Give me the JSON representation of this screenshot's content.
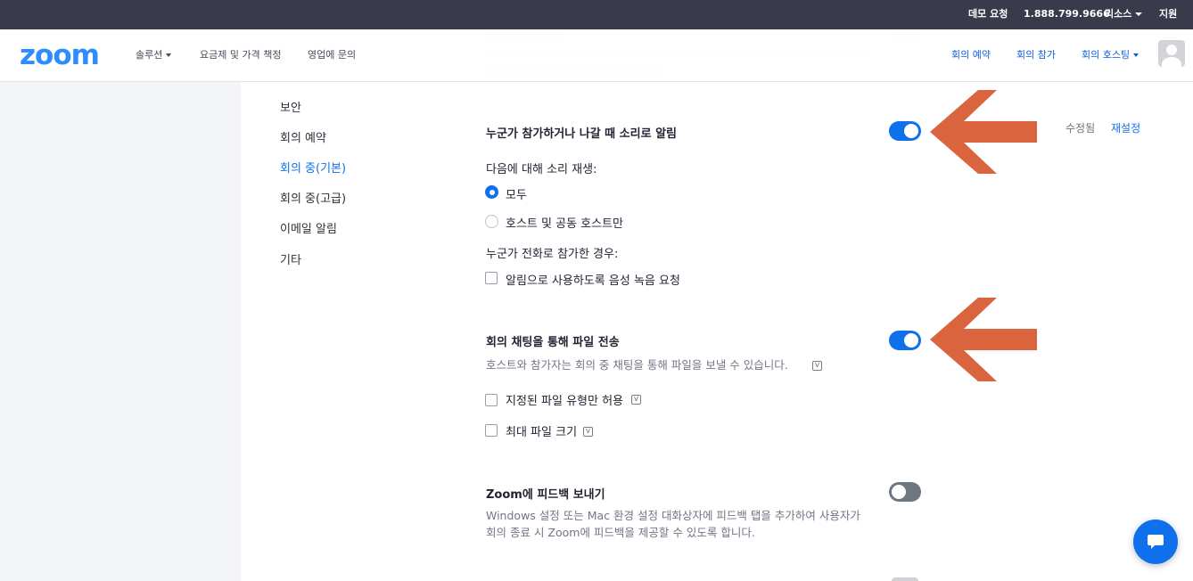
{
  "topbar": {
    "demo": "데모 요청",
    "phone": "1.888.799.9666",
    "resources": "리소스",
    "support": "지원"
  },
  "nav": {
    "logo": "zoom",
    "solutions": "솔루션",
    "pricing": "요금제 및 가격 책정",
    "contact_sales": "영업에 문의",
    "schedule": "회의 예약",
    "join": "회의 참가",
    "host": "회의 호스팅"
  },
  "sidebar": {
    "items": [
      {
        "label": "보안"
      },
      {
        "label": "회의 예약"
      },
      {
        "label": "회의 중(기본)"
      },
      {
        "label": "회의 중(고급)"
      },
      {
        "label": "이메일 알림"
      },
      {
        "label": "기타"
      }
    ]
  },
  "settings": {
    "sound": {
      "title": "누군가 참가하거나 나갈 때 소리로 알림",
      "play_for": "다음에 대해 소리 재생:",
      "opt_all": "모두",
      "opt_host": "호스트 및 공동 호스트만",
      "phone_join": "누군가 전화로 참가한 경우:",
      "record_name": "알림으로 사용하도록 음성 녹음 요청",
      "modified": "수정됨",
      "reset": "재설정",
      "enabled": true
    },
    "file_transfer": {
      "title": "회의 채팅을 통해 파일 전송",
      "desc": "호스트와 참가자는 회의 중 채팅을 통해 파일을 보낼 수 있습니다.",
      "opt_types": "지정된 파일 유형만 허용",
      "opt_size": "최대 파일 크기",
      "enabled": true
    },
    "feedback": {
      "title": "Zoom에 피드백 보내기",
      "desc": "Windows 설정 또는 Mac 환경 설정 대화상자에 피드백 탭을 추가하여 사용자가 회의 종료 시 Zoom에 피드백을 제공할 수 있도록 합니다.",
      "enabled": false
    }
  },
  "colors": {
    "accent": "#0e71eb",
    "arrow": "#d9643e",
    "topbar": "#393a4c"
  }
}
